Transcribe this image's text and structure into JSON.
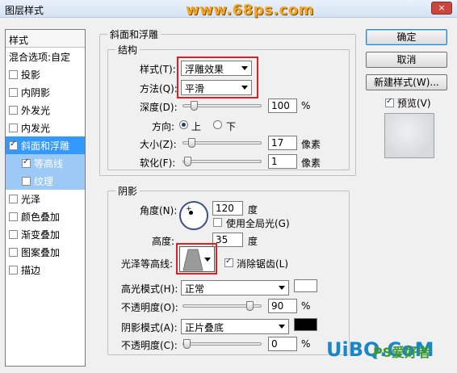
{
  "window": {
    "title": "图层样式",
    "watermark": "www.68ps.com",
    "close": "×"
  },
  "style_list": {
    "header": "样式",
    "items": [
      {
        "label": "混合选项:自定",
        "checkbox": false,
        "checked": false
      },
      {
        "label": "投影",
        "checkbox": true,
        "checked": false
      },
      {
        "label": "内阴影",
        "checkbox": true,
        "checked": false
      },
      {
        "label": "外发光",
        "checkbox": true,
        "checked": false
      },
      {
        "label": "内发光",
        "checkbox": true,
        "checked": false
      },
      {
        "label": "斜面和浮雕",
        "checkbox": true,
        "checked": true,
        "selected": true
      },
      {
        "label": "等高线",
        "checkbox": true,
        "checked": true,
        "sub": true,
        "subsel": true
      },
      {
        "label": "纹理",
        "checkbox": true,
        "checked": false,
        "sub": true,
        "subsel": true
      },
      {
        "label": "光泽",
        "checkbox": true,
        "checked": false
      },
      {
        "label": "颜色叠加",
        "checkbox": true,
        "checked": false
      },
      {
        "label": "渐变叠加",
        "checkbox": true,
        "checked": false
      },
      {
        "label": "图案叠加",
        "checkbox": true,
        "checked": false
      },
      {
        "label": "描边",
        "checkbox": true,
        "checked": false
      }
    ]
  },
  "buttons": {
    "ok": "确定",
    "cancel": "取消",
    "new_style": "新建样式(W)...",
    "preview": "预览(V)",
    "preview_checked": true
  },
  "bevel": {
    "group_title": "斜面和浮雕",
    "structure_title": "结构",
    "style_label": "样式(T):",
    "style_value": "浮雕效果",
    "technique_label": "方法(Q):",
    "technique_value": "平滑",
    "depth_label": "深度(D):",
    "depth_value": "100",
    "depth_unit": "%",
    "depth_level": 0.1,
    "direction_label": "方向:",
    "direction_up": "上",
    "direction_down": "下",
    "direction_selected": "up",
    "size_label": "大小(Z):",
    "size_value": "17",
    "size_unit": "像素",
    "size_level": 0.07,
    "soften_label": "软化(F):",
    "soften_value": "1",
    "soften_unit": "像素",
    "soften_level": 0.01
  },
  "shading": {
    "title": "阴影",
    "angle_label": "角度(N):",
    "angle_value": "120",
    "angle_unit": "度",
    "global_light_label": "使用全局光(G)",
    "global_light_checked": false,
    "altitude_label": "高度:",
    "altitude_value": "35",
    "altitude_unit": "度",
    "gloss_contour_label": "光泽等高线:",
    "antialias_label": "消除锯齿(L)",
    "antialias_checked": true,
    "highlight_mode_label": "高光模式(H):",
    "highlight_mode_value": "正常",
    "highlight_color": "#ffffff",
    "highlight_opacity_label": "不透明度(O):",
    "highlight_opacity_value": "90",
    "highlight_opacity_unit": "%",
    "highlight_opacity_level": 0.9,
    "shadow_mode_label": "阴影模式(A):",
    "shadow_mode_value": "正片叠底",
    "shadow_color": "#000000",
    "shadow_opacity_label": "不透明度(C):",
    "shadow_opacity_value": "0",
    "shadow_opacity_unit": "%",
    "shadow_opacity_level": 0.0
  },
  "branding": {
    "logo": "UiBQ.CoM",
    "logo2": "PS爱好者"
  }
}
